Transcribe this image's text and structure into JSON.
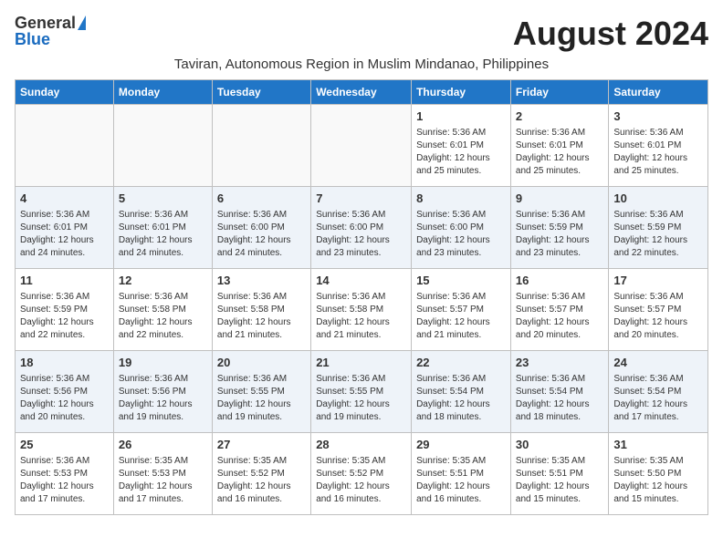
{
  "header": {
    "logo_general": "General",
    "logo_blue": "Blue",
    "month_title": "August 2024",
    "subtitle": "Taviran, Autonomous Region in Muslim Mindanao, Philippines"
  },
  "columns": [
    "Sunday",
    "Monday",
    "Tuesday",
    "Wednesday",
    "Thursday",
    "Friday",
    "Saturday"
  ],
  "weeks": [
    {
      "shaded": false,
      "days": [
        {
          "number": "",
          "info": ""
        },
        {
          "number": "",
          "info": ""
        },
        {
          "number": "",
          "info": ""
        },
        {
          "number": "",
          "info": ""
        },
        {
          "number": "1",
          "info": "Sunrise: 5:36 AM\nSunset: 6:01 PM\nDaylight: 12 hours\nand 25 minutes."
        },
        {
          "number": "2",
          "info": "Sunrise: 5:36 AM\nSunset: 6:01 PM\nDaylight: 12 hours\nand 25 minutes."
        },
        {
          "number": "3",
          "info": "Sunrise: 5:36 AM\nSunset: 6:01 PM\nDaylight: 12 hours\nand 25 minutes."
        }
      ]
    },
    {
      "shaded": true,
      "days": [
        {
          "number": "4",
          "info": "Sunrise: 5:36 AM\nSunset: 6:01 PM\nDaylight: 12 hours\nand 24 minutes."
        },
        {
          "number": "5",
          "info": "Sunrise: 5:36 AM\nSunset: 6:01 PM\nDaylight: 12 hours\nand 24 minutes."
        },
        {
          "number": "6",
          "info": "Sunrise: 5:36 AM\nSunset: 6:00 PM\nDaylight: 12 hours\nand 24 minutes."
        },
        {
          "number": "7",
          "info": "Sunrise: 5:36 AM\nSunset: 6:00 PM\nDaylight: 12 hours\nand 23 minutes."
        },
        {
          "number": "8",
          "info": "Sunrise: 5:36 AM\nSunset: 6:00 PM\nDaylight: 12 hours\nand 23 minutes."
        },
        {
          "number": "9",
          "info": "Sunrise: 5:36 AM\nSunset: 5:59 PM\nDaylight: 12 hours\nand 23 minutes."
        },
        {
          "number": "10",
          "info": "Sunrise: 5:36 AM\nSunset: 5:59 PM\nDaylight: 12 hours\nand 22 minutes."
        }
      ]
    },
    {
      "shaded": false,
      "days": [
        {
          "number": "11",
          "info": "Sunrise: 5:36 AM\nSunset: 5:59 PM\nDaylight: 12 hours\nand 22 minutes."
        },
        {
          "number": "12",
          "info": "Sunrise: 5:36 AM\nSunset: 5:58 PM\nDaylight: 12 hours\nand 22 minutes."
        },
        {
          "number": "13",
          "info": "Sunrise: 5:36 AM\nSunset: 5:58 PM\nDaylight: 12 hours\nand 21 minutes."
        },
        {
          "number": "14",
          "info": "Sunrise: 5:36 AM\nSunset: 5:58 PM\nDaylight: 12 hours\nand 21 minutes."
        },
        {
          "number": "15",
          "info": "Sunrise: 5:36 AM\nSunset: 5:57 PM\nDaylight: 12 hours\nand 21 minutes."
        },
        {
          "number": "16",
          "info": "Sunrise: 5:36 AM\nSunset: 5:57 PM\nDaylight: 12 hours\nand 20 minutes."
        },
        {
          "number": "17",
          "info": "Sunrise: 5:36 AM\nSunset: 5:57 PM\nDaylight: 12 hours\nand 20 minutes."
        }
      ]
    },
    {
      "shaded": true,
      "days": [
        {
          "number": "18",
          "info": "Sunrise: 5:36 AM\nSunset: 5:56 PM\nDaylight: 12 hours\nand 20 minutes."
        },
        {
          "number": "19",
          "info": "Sunrise: 5:36 AM\nSunset: 5:56 PM\nDaylight: 12 hours\nand 19 minutes."
        },
        {
          "number": "20",
          "info": "Sunrise: 5:36 AM\nSunset: 5:55 PM\nDaylight: 12 hours\nand 19 minutes."
        },
        {
          "number": "21",
          "info": "Sunrise: 5:36 AM\nSunset: 5:55 PM\nDaylight: 12 hours\nand 19 minutes."
        },
        {
          "number": "22",
          "info": "Sunrise: 5:36 AM\nSunset: 5:54 PM\nDaylight: 12 hours\nand 18 minutes."
        },
        {
          "number": "23",
          "info": "Sunrise: 5:36 AM\nSunset: 5:54 PM\nDaylight: 12 hours\nand 18 minutes."
        },
        {
          "number": "24",
          "info": "Sunrise: 5:36 AM\nSunset: 5:54 PM\nDaylight: 12 hours\nand 17 minutes."
        }
      ]
    },
    {
      "shaded": false,
      "days": [
        {
          "number": "25",
          "info": "Sunrise: 5:36 AM\nSunset: 5:53 PM\nDaylight: 12 hours\nand 17 minutes."
        },
        {
          "number": "26",
          "info": "Sunrise: 5:35 AM\nSunset: 5:53 PM\nDaylight: 12 hours\nand 17 minutes."
        },
        {
          "number": "27",
          "info": "Sunrise: 5:35 AM\nSunset: 5:52 PM\nDaylight: 12 hours\nand 16 minutes."
        },
        {
          "number": "28",
          "info": "Sunrise: 5:35 AM\nSunset: 5:52 PM\nDaylight: 12 hours\nand 16 minutes."
        },
        {
          "number": "29",
          "info": "Sunrise: 5:35 AM\nSunset: 5:51 PM\nDaylight: 12 hours\nand 16 minutes."
        },
        {
          "number": "30",
          "info": "Sunrise: 5:35 AM\nSunset: 5:51 PM\nDaylight: 12 hours\nand 15 minutes."
        },
        {
          "number": "31",
          "info": "Sunrise: 5:35 AM\nSunset: 5:50 PM\nDaylight: 12 hours\nand 15 minutes."
        }
      ]
    }
  ]
}
